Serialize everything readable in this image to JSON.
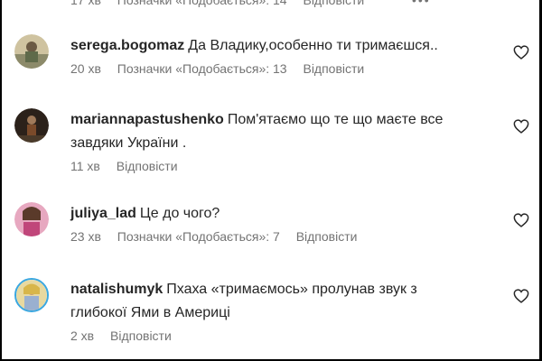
{
  "top_partial": {
    "time": "17 хв",
    "likes": "Позначки «Подобається»: 14",
    "reply": "Відповісти",
    "more": "•••"
  },
  "comments": [
    {
      "username": "serega.bogomaz",
      "text": "Да Владику,особенно ти тримаєшся..",
      "time": "20 хв",
      "likes": "Позначки «Подобається»: 13",
      "reply": "Відповісти",
      "avatar_color": "#b9a77a"
    },
    {
      "username": "mariannapastushenko",
      "text": "Пом'ятаємо що те що маєте все завдяки України .",
      "time": "11 хв",
      "likes": "",
      "reply": "Відповісти",
      "avatar_color": "#3a2a20"
    },
    {
      "username": "juliya_lad",
      "text": "Це до чого?",
      "time": "23 хв",
      "likes": "Позначки «Подобається»: 7",
      "reply": "Відповісти",
      "avatar_color": "#c0467a"
    },
    {
      "username": "natalishumyk",
      "text": "Пхаха «тримаємось» пролунав звук з глибокої Ями в Америці",
      "time": "2 хв",
      "likes": "",
      "reply": "Відповісти",
      "avatar_color": "#d8c36a"
    }
  ],
  "icons": {
    "like": "heart-outline-icon"
  }
}
